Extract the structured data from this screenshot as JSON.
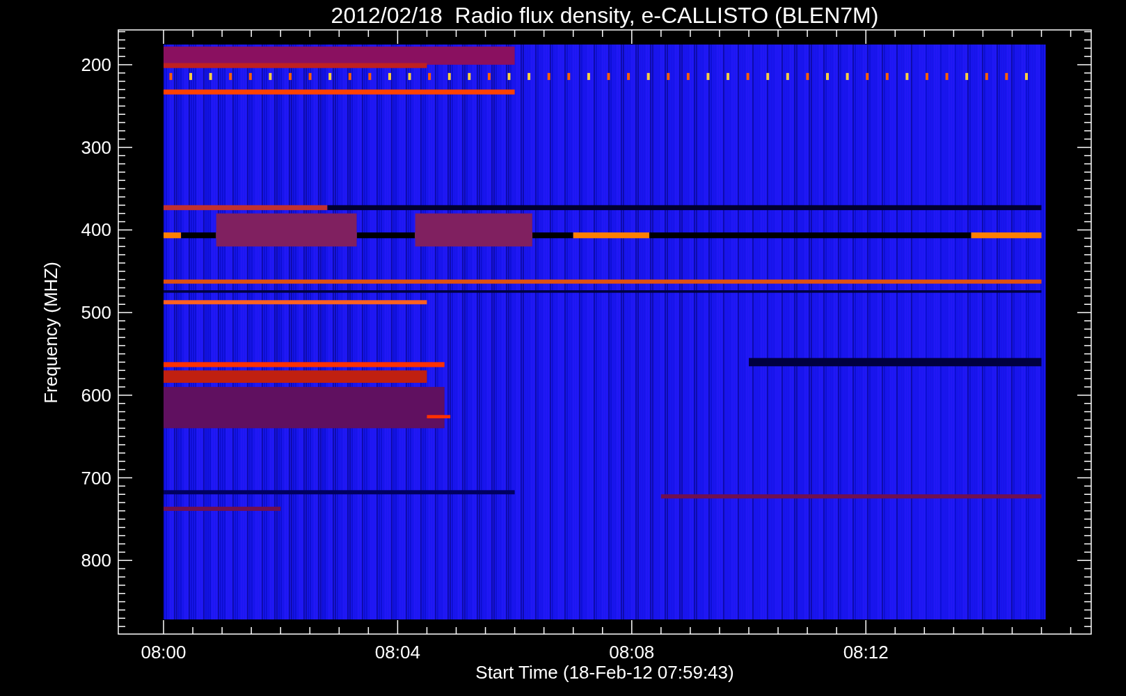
{
  "title": "2012/02/18  Radio flux density, e-CALLISTO (BLEN7M)",
  "y_axis": {
    "label": "Frequency (MHZ)",
    "ticks": [
      "200",
      "300",
      "400",
      "500",
      "600",
      "700",
      "800"
    ]
  },
  "x_axis": {
    "label": "Start Time (18-Feb-12 07:59:43)",
    "ticks": [
      "08:00",
      "08:04",
      "08:08",
      "08:12"
    ]
  }
}
